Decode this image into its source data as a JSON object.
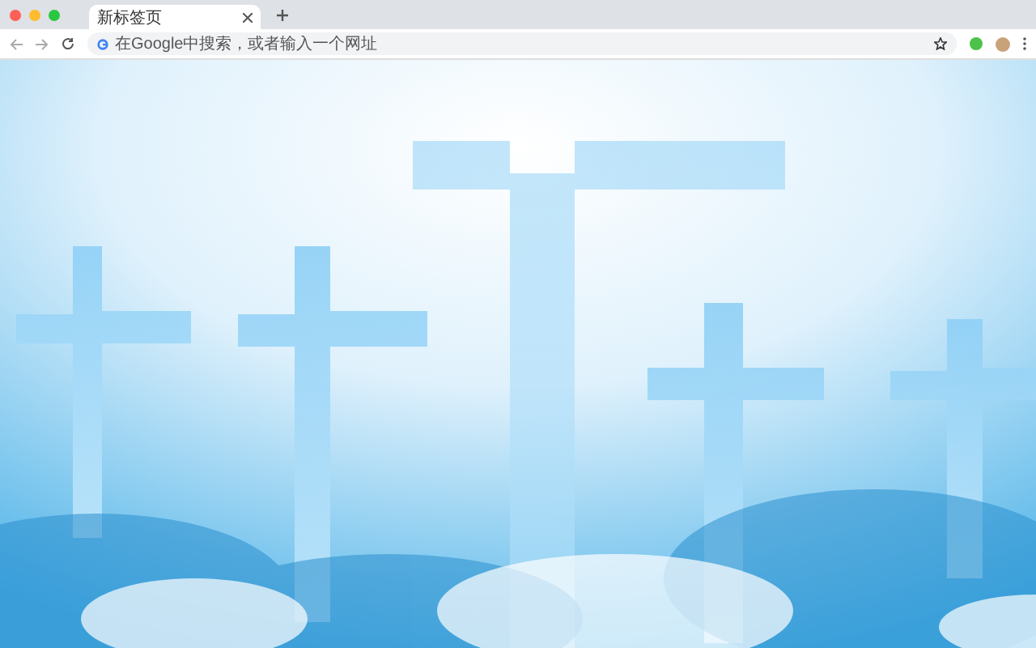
{
  "tabs": [
    {
      "title": "新标签页",
      "selected": true
    }
  ],
  "omnibox": {
    "placeholder": "在Google中搜索，或者输入一个网址"
  }
}
